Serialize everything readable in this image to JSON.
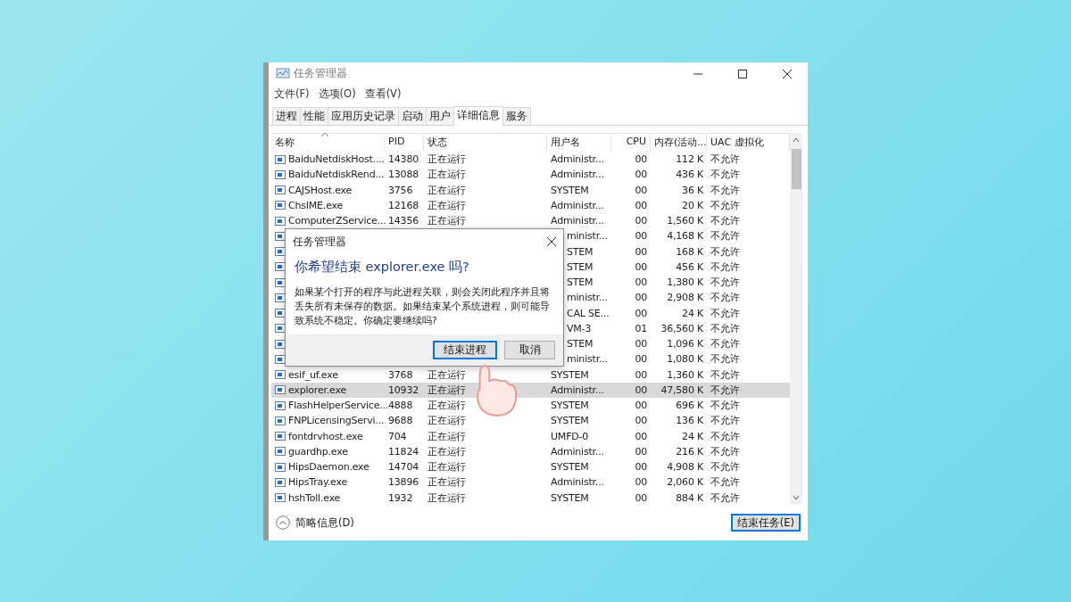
{
  "window": {
    "title": "任务管理器"
  },
  "menu": [
    "文件(F)",
    "选项(O)",
    "查看(V)"
  ],
  "tabs": [
    {
      "label": "进程",
      "selected": false
    },
    {
      "label": "性能",
      "selected": false
    },
    {
      "label": "应用历史记录",
      "selected": false
    },
    {
      "label": "启动",
      "selected": false
    },
    {
      "label": "用户",
      "selected": false
    },
    {
      "label": "详细信息",
      "selected": true
    },
    {
      "label": "服务",
      "selected": false
    }
  ],
  "table": {
    "columns": [
      "名称",
      "PID",
      "状态",
      "用户名",
      "CPU",
      "内存(活动...",
      "UAC 虚拟化"
    ],
    "rows": [
      {
        "kind": "full",
        "name": "BaiduNetdiskHost....",
        "pid": "14380",
        "status": "正在运行",
        "user": "Administr...",
        "cpu": "00",
        "memory": "112 K",
        "uac": "不允许",
        "selected": false
      },
      {
        "kind": "full",
        "name": "BaiduNetdiskRend...",
        "pid": "13088",
        "status": "正在运行",
        "user": "Administr...",
        "cpu": "00",
        "memory": "436 K",
        "uac": "不允许",
        "selected": false
      },
      {
        "kind": "full",
        "name": "CAJSHost.exe",
        "pid": "3756",
        "status": "正在运行",
        "user": "SYSTEM",
        "cpu": "00",
        "memory": "36 K",
        "uac": "不允许",
        "selected": false
      },
      {
        "kind": "full",
        "name": "ChsIME.exe",
        "pid": "12168",
        "status": "正在运行",
        "user": "Administr...",
        "cpu": "00",
        "memory": "20 K",
        "uac": "不允许",
        "selected": false
      },
      {
        "kind": "full",
        "name": "ComputerZService...",
        "pid": "14356",
        "status": "正在运行",
        "user": "Administr...",
        "cpu": "00",
        "memory": "1,560 K",
        "uac": "不允许",
        "selected": false
      },
      {
        "kind": "covered",
        "user": "ministr...",
        "cpu": "00",
        "memory": "4,168 K",
        "uac": "不允许",
        "selected": false
      },
      {
        "kind": "covered",
        "user": "STEM",
        "cpu": "00",
        "memory": "168 K",
        "uac": "不允许",
        "selected": false
      },
      {
        "kind": "covered",
        "user": "STEM",
        "cpu": "00",
        "memory": "456 K",
        "uac": "不允许",
        "selected": false
      },
      {
        "kind": "covered",
        "user": "STEM",
        "cpu": "00",
        "memory": "1,380 K",
        "uac": "不允许",
        "selected": false
      },
      {
        "kind": "covered",
        "user": "ministr...",
        "cpu": "00",
        "memory": "2,908 K",
        "uac": "不允许",
        "selected": false
      },
      {
        "kind": "covered",
        "user": "CAL SE...",
        "cpu": "00",
        "memory": "24 K",
        "uac": "不允许",
        "selected": false
      },
      {
        "kind": "covered",
        "user": "VM-3",
        "cpu": "01",
        "memory": "36,560 K",
        "uac": "不允许",
        "selected": false
      },
      {
        "kind": "covered",
        "user": "STEM",
        "cpu": "00",
        "memory": "1,096 K",
        "uac": "不允许",
        "selected": false
      },
      {
        "kind": "covered",
        "user": "ministr...",
        "cpu": "00",
        "memory": "1,080 K",
        "uac": "不允许",
        "selected": false
      },
      {
        "kind": "full",
        "name": "esif_uf.exe",
        "pid": "3768",
        "status": "正在运行",
        "user": "SYSTEM",
        "cpu": "00",
        "memory": "1,360 K",
        "uac": "不允许",
        "selected": false
      },
      {
        "kind": "full",
        "name": "explorer.exe",
        "pid": "10932",
        "status": "正在运行",
        "user": "Administr...",
        "cpu": "00",
        "memory": "47,580 K",
        "uac": "不允许",
        "selected": true
      },
      {
        "kind": "full",
        "name": "FlashHelperService...",
        "pid": "4888",
        "status": "正在运行",
        "user": "SYSTEM",
        "cpu": "00",
        "memory": "696 K",
        "uac": "不允许",
        "selected": false
      },
      {
        "kind": "full",
        "name": "FNPLicensingServi...",
        "pid": "9688",
        "status": "正在运行",
        "user": "SYSTEM",
        "cpu": "00",
        "memory": "136 K",
        "uac": "不允许",
        "selected": false
      },
      {
        "kind": "full",
        "name": "fontdrvhost.exe",
        "pid": "704",
        "status": "正在运行",
        "user": "UMFD-0",
        "cpu": "00",
        "memory": "24 K",
        "uac": "不允许",
        "selected": false
      },
      {
        "kind": "full",
        "name": "guardhp.exe",
        "pid": "11824",
        "status": "正在运行",
        "user": "Administr...",
        "cpu": "00",
        "memory": "216 K",
        "uac": "不允许",
        "selected": false
      },
      {
        "kind": "full",
        "name": "HipsDaemon.exe",
        "pid": "14704",
        "status": "正在运行",
        "user": "SYSTEM",
        "cpu": "00",
        "memory": "4,908 K",
        "uac": "不允许",
        "selected": false
      },
      {
        "kind": "full",
        "name": "HipsTray.exe",
        "pid": "13896",
        "status": "正在运行",
        "user": "Administr...",
        "cpu": "00",
        "memory": "2,060 K",
        "uac": "不允许",
        "selected": false
      },
      {
        "kind": "full",
        "name": "hshToll.exe",
        "pid": "1932",
        "status": "正在运行",
        "user": "SYSTEM",
        "cpu": "00",
        "memory": "884 K",
        "uac": "不允许",
        "selected": false
      }
    ]
  },
  "footer": {
    "details_toggle": "简略信息(D)",
    "end_task_button": "结束任务(E)"
  },
  "dialog": {
    "title": "任务管理器",
    "heading": "你希望结束 explorer.exe 吗?",
    "message": "如果某个打开的程序与此进程关联，则会关闭此程序并且将丢失所有未保存的数据。如果结束某个系统进程，则可能导致系统不稳定。你确定要继续吗?",
    "buttons": [
      {
        "label": "结束进程",
        "selected": true
      },
      {
        "label": "取消",
        "selected": false
      }
    ]
  }
}
